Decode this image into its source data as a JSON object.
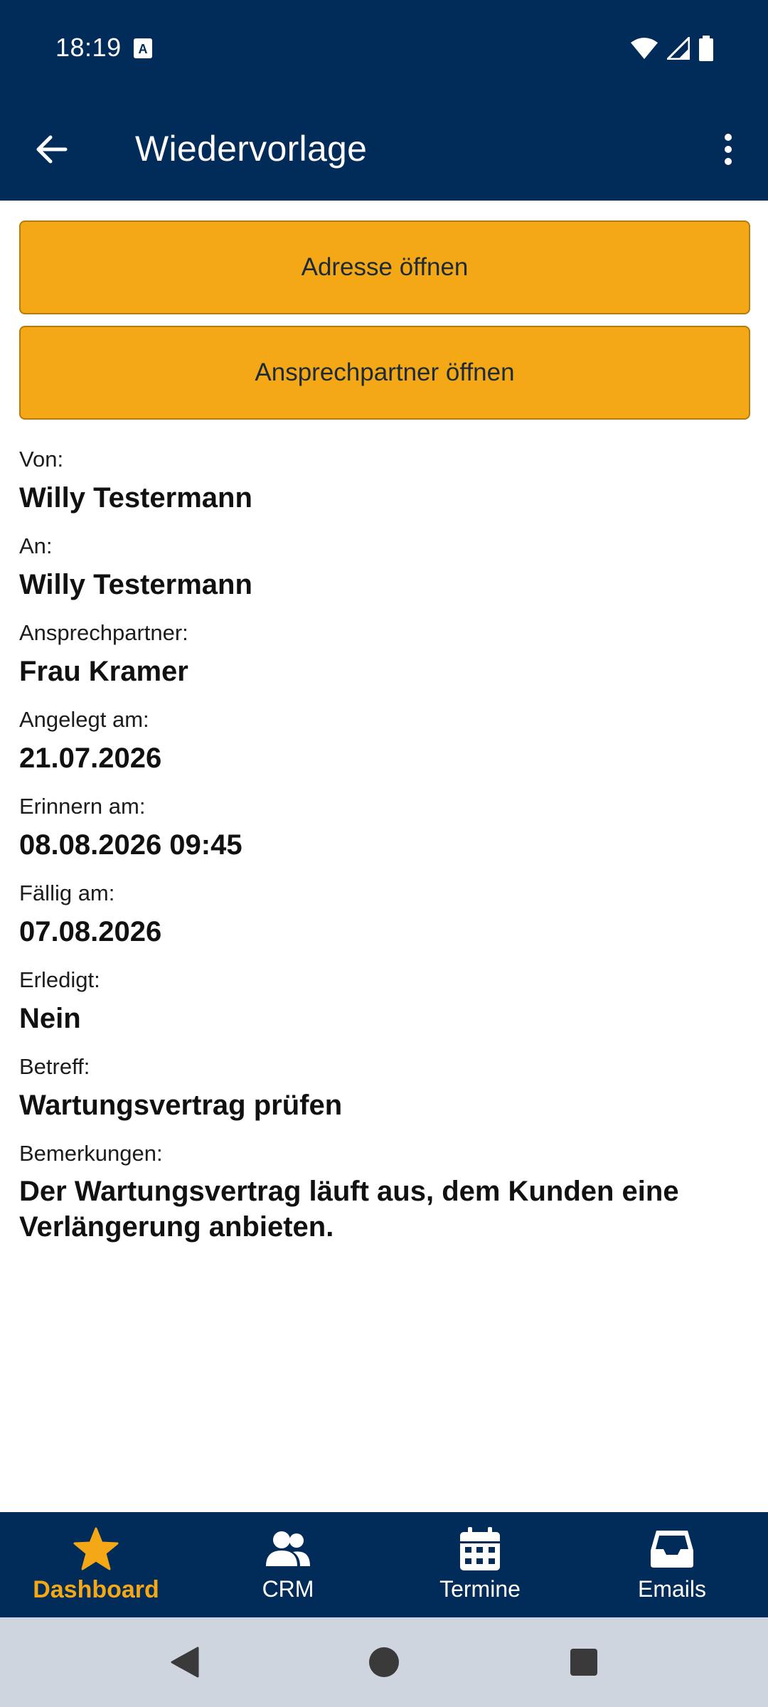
{
  "status_bar": {
    "time": "18:19"
  },
  "app_bar": {
    "title": "Wiedervorlage",
    "back_icon": "arrow-back-icon",
    "more_icon": "more-vert-icon"
  },
  "actions": {
    "open_address": "Adresse öffnen",
    "open_contact": "Ansprechpartner öffnen"
  },
  "details": [
    {
      "label": "Von:",
      "value": "Willy Testermann"
    },
    {
      "label": "An:",
      "value": "Willy Testermann"
    },
    {
      "label": "Ansprechpartner:",
      "value": "Frau Kramer"
    },
    {
      "label": "Angelegt am:",
      "value": "21.07.2026"
    },
    {
      "label": "Erinnern am:",
      "value": "08.08.2026 09:45"
    },
    {
      "label": "Fällig am:",
      "value": "07.08.2026"
    },
    {
      "label": "Erledigt:",
      "value": "Nein"
    },
    {
      "label": "Betreff:",
      "value": "Wartungsvertrag prüfen"
    },
    {
      "label": "Bemerkungen:",
      "value": "Der Wartungsvertrag läuft aus, dem Kunden eine Verlängerung anbieten."
    }
  ],
  "bottom_nav": [
    {
      "label": "Dashboard",
      "icon": "star-icon",
      "active": true
    },
    {
      "label": "CRM",
      "icon": "users-icon",
      "active": false
    },
    {
      "label": "Termine",
      "icon": "calendar-icon",
      "active": false
    },
    {
      "label": "Emails",
      "icon": "inbox-icon",
      "active": false
    }
  ],
  "colors": {
    "primary": "#012c5a",
    "accent": "#f4a816",
    "system_nav": "#cfd5de"
  }
}
